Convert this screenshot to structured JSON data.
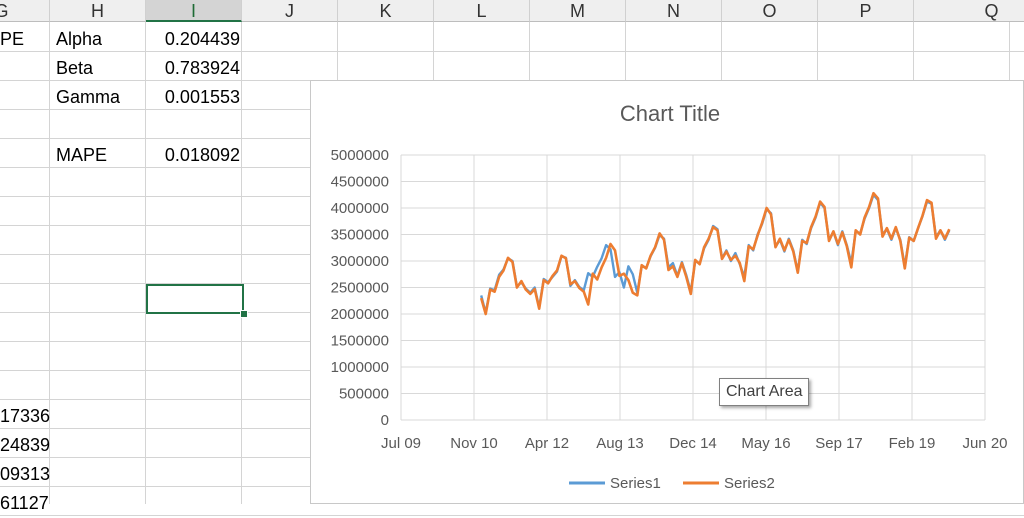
{
  "columns": [
    {
      "id": "G",
      "label": "G"
    },
    {
      "id": "H",
      "label": "H"
    },
    {
      "id": "I",
      "label": "I"
    },
    {
      "id": "J",
      "label": "J"
    },
    {
      "id": "K",
      "label": "K"
    },
    {
      "id": "L",
      "label": "L"
    },
    {
      "id": "M",
      "label": "M"
    },
    {
      "id": "N",
      "label": "N"
    },
    {
      "id": "O",
      "label": "O"
    },
    {
      "id": "P",
      "label": "P"
    },
    {
      "id": "Q",
      "label": "Q"
    }
  ],
  "selected_column": "I",
  "cells": {
    "g1": "PE",
    "alpha_label": "Alpha",
    "alpha_value": "0.204439",
    "beta_label": "Beta",
    "beta_value": "0.783924",
    "gamma_label": "Gamma",
    "gamma_value": "0.001553",
    "mape_label": "MAPE",
    "mape_value": "0.018092",
    "g15": "17336",
    "g16": "24839",
    "g17": "09313",
    "g18": "61127"
  },
  "colors": {
    "series1": "#5b9bd5",
    "series2": "#ed7d31",
    "selection": "#217346",
    "gridline": "#d9d9d9"
  },
  "tooltip": "Chart Area",
  "chart_data": {
    "type": "line",
    "title": "Chart Title",
    "x_axis": {
      "ticks": [
        "Jul 09",
        "Nov 10",
        "Apr 12",
        "Aug 13",
        "Dec 14",
        "May 16",
        "Sep 17",
        "Feb 19",
        "Jun 20"
      ],
      "range": [
        "2009-07",
        "2020-06"
      ]
    },
    "y_axis": {
      "ticks": [
        0,
        500000,
        1000000,
        1500000,
        2000000,
        2500000,
        3000000,
        3500000,
        4000000,
        4500000,
        5000000
      ],
      "ylim": [
        0,
        5000000
      ]
    },
    "grid": true,
    "legend": "bottom",
    "x_start": "2011-01",
    "x_end": "2020-03",
    "x_step": "month",
    "series": [
      {
        "name": "Series1",
        "values": [
          2350000,
          2020000,
          2480000,
          2450000,
          2740000,
          2840000,
          3050000,
          3000000,
          2520000,
          2600000,
          2480000,
          2400000,
          2500000,
          2120000,
          2660000,
          2600000,
          2700000,
          2800000,
          3090000,
          3060000,
          2530000,
          2640000,
          2510000,
          2450000,
          2770000,
          2700000,
          2890000,
          3050000,
          3300000,
          3220000,
          2700000,
          2790000,
          2500000,
          2900000,
          2750000,
          2400000,
          2900000,
          2870000,
          3090000,
          3250000,
          3490000,
          3420000,
          2880000,
          2960000,
          2720000,
          2980000,
          2730000,
          2420000,
          3000000,
          2950000,
          3240000,
          3400000,
          3660000,
          3600000,
          3050000,
          3200000,
          3000000,
          3150000,
          2940000,
          2700000,
          3300000,
          3200000,
          3500000,
          3700000,
          3980000,
          3900000,
          3270000,
          3400000,
          3180000,
          3420000,
          3200000,
          2800000,
          3400000,
          3320000,
          3620000,
          3820000,
          4100000,
          4000000,
          3400000,
          3550000,
          3300000,
          3560000,
          3300000,
          2960000,
          3560000,
          3520000,
          3800000,
          4000000,
          4250000,
          4150000,
          3500000,
          3600000,
          3400000,
          3620000,
          3400000,
          2900000,
          3450000,
          3380000,
          3620000,
          3850000,
          4120000,
          4080000,
          3450000,
          3580000,
          3400000,
          3580000
        ]
      },
      {
        "name": "Series2",
        "values": [
          2300000,
          2000000,
          2460000,
          2420000,
          2700000,
          2820000,
          3060000,
          2980000,
          2500000,
          2620000,
          2460000,
          2380000,
          2470000,
          2100000,
          2640000,
          2580000,
          2720000,
          2820000,
          3100000,
          3050000,
          2560000,
          2620000,
          2490000,
          2420000,
          2180000,
          2760000,
          2650000,
          2880000,
          3060000,
          3320000,
          3200000,
          2720000,
          2760000,
          2640000,
          2400000,
          2350000,
          2920000,
          2860000,
          3100000,
          3260000,
          3520000,
          3400000,
          2830000,
          2900000,
          2700000,
          2960000,
          2700000,
          2380000,
          3020000,
          2940000,
          3260000,
          3420000,
          3640000,
          3580000,
          3040000,
          3180000,
          3020000,
          3100000,
          2960000,
          2620000,
          3280000,
          3220000,
          3480000,
          3720000,
          4000000,
          3880000,
          3260000,
          3420000,
          3200000,
          3400000,
          3180000,
          2780000,
          3380000,
          3340000,
          3640000,
          3840000,
          4120000,
          4020000,
          3380000,
          3560000,
          3320000,
          3540000,
          3280000,
          2880000,
          3580000,
          3500000,
          3820000,
          4020000,
          4280000,
          4180000,
          3460000,
          3620000,
          3420000,
          3640000,
          3380000,
          2860000,
          3440000,
          3380000,
          3620000,
          3860000,
          4150000,
          4100000,
          3420000,
          3580000,
          3420000,
          3600000
        ]
      }
    ]
  }
}
